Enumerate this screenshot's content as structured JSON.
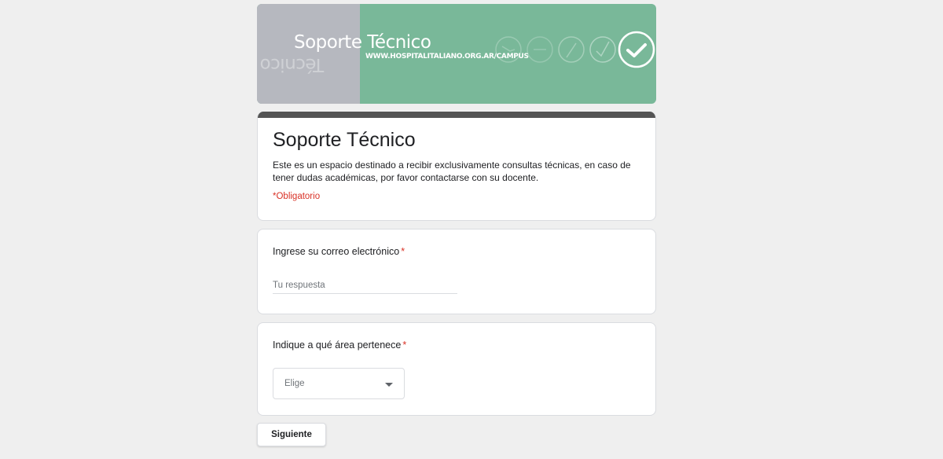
{
  "banner": {
    "title": "Soporte Técnico",
    "mirror_text": "Técnico",
    "url": "WWW.HOSPITALITALIANO.ORG.AR/CAMPUS",
    "colors": {
      "left_panel": "#b6b8bf",
      "main": "#79b899"
    }
  },
  "header": {
    "title": "Soporte Técnico",
    "description": "Este es un espacio destinado a recibir exclusivamente consultas técnicas, en caso de tener dudas académicas, por favor contactarse con su docente.",
    "required_note": "*Obligatorio",
    "accent_color": "#545454"
  },
  "questions": [
    {
      "label": "Ingrese su correo electrónico",
      "required_mark": "*",
      "placeholder": "Tu respuesta",
      "value": ""
    },
    {
      "label": "Indique a qué área pertenece",
      "required_mark": "*",
      "selected": "Elige"
    }
  ],
  "footer": {
    "next_label": "Siguiente"
  },
  "icons": [
    "banner-circle-icon",
    "checkmark-icon",
    "chevron-down-icon"
  ]
}
